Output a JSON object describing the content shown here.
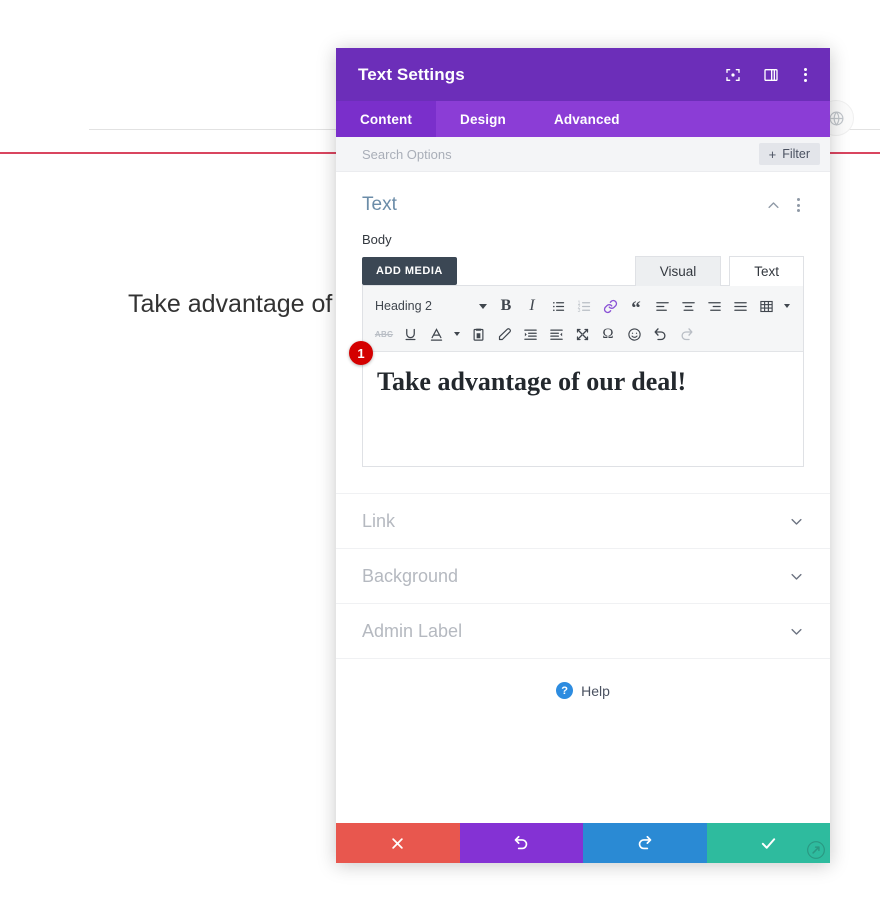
{
  "background_page": {
    "heading_text": "Take advantage of our deal!",
    "accent_rule_color": "#d9455f",
    "globe_icon": "globe-icon"
  },
  "panel": {
    "header": {
      "title": "Text Settings",
      "background_color": "#6c2eb9",
      "icons": [
        {
          "name": "focus-target-icon"
        },
        {
          "name": "layout-panel-icon"
        },
        {
          "name": "kebab-menu-icon"
        }
      ]
    },
    "tabs": {
      "background_color": "#8b3dd6",
      "active_color": "#7a2fcb",
      "items": [
        {
          "label": "Content",
          "active": true
        },
        {
          "label": "Design",
          "active": false
        },
        {
          "label": "Advanced",
          "active": false
        }
      ]
    },
    "search": {
      "value": "",
      "placeholder": "Search Options",
      "filter_label": "Filter",
      "filter_plus": "+"
    },
    "text_section": {
      "title": "Text",
      "collapse_icon": "chevron-up-icon",
      "menu_icon": "kebab-menu-icon",
      "body_label": "Body",
      "add_media_label": "ADD MEDIA",
      "editor_tabs": [
        {
          "label": "Visual",
          "active": true
        },
        {
          "label": "Text",
          "active": false
        }
      ],
      "toolbar_row1": [
        {
          "name": "format-select",
          "label": "Heading 2",
          "type": "select"
        },
        {
          "name": "bold-icon",
          "glyph": "B",
          "type": "text",
          "style": "bold-serif"
        },
        {
          "name": "italic-icon",
          "glyph": "I",
          "type": "text",
          "style": "italic-serif"
        },
        {
          "name": "bulleted-list-icon",
          "type": "svg"
        },
        {
          "name": "numbered-list-icon",
          "type": "svg"
        },
        {
          "name": "link-icon",
          "type": "svg",
          "color": "#8a52d6"
        },
        {
          "name": "blockquote-icon",
          "glyph": "“",
          "type": "text"
        },
        {
          "name": "align-left-icon",
          "type": "svg"
        },
        {
          "name": "align-center-icon",
          "type": "svg"
        },
        {
          "name": "align-right-icon",
          "type": "svg"
        },
        {
          "name": "align-justify-icon",
          "type": "svg"
        },
        {
          "name": "insert-table-icon",
          "type": "svg"
        },
        {
          "name": "table-caret-icon",
          "type": "caret"
        }
      ],
      "toolbar_row2": [
        {
          "name": "strikethrough-icon",
          "glyph": "ABC",
          "type": "abc"
        },
        {
          "name": "underline-icon",
          "type": "svg"
        },
        {
          "name": "text-color-icon",
          "type": "svg"
        },
        {
          "name": "text-color-caret-icon",
          "type": "caret"
        },
        {
          "name": "paste-as-text-icon",
          "type": "svg"
        },
        {
          "name": "clear-formatting-icon",
          "type": "svg"
        },
        {
          "name": "increase-indent-icon",
          "type": "svg"
        },
        {
          "name": "decrease-indent-icon",
          "type": "svg"
        },
        {
          "name": "fullscreen-icon",
          "type": "svg"
        },
        {
          "name": "special-character-icon",
          "glyph": "Ω",
          "type": "text"
        },
        {
          "name": "emoji-icon",
          "type": "svg"
        },
        {
          "name": "undo-icon",
          "type": "svg"
        },
        {
          "name": "redo-icon",
          "type": "svg",
          "disabled": true
        }
      ],
      "content_html_text": "Take advantage of our deal!",
      "step_badge": "1",
      "step_badge_color": "#d40000"
    },
    "collapsed_sections": [
      {
        "label": "Link",
        "icon": "chevron-down-icon"
      },
      {
        "label": "Background",
        "icon": "chevron-down-icon"
      },
      {
        "label": "Admin Label",
        "icon": "chevron-down-icon"
      }
    ],
    "help": {
      "label": "Help",
      "icon": "question-mark-icon",
      "icon_color": "#2d8ce0"
    },
    "footer_actions": [
      {
        "name": "cancel-button",
        "icon": "close-x-icon",
        "color": "#e8574e"
      },
      {
        "name": "undo-button",
        "icon": "undo-arrow-icon",
        "color": "#8432d4"
      },
      {
        "name": "redo-button",
        "icon": "redo-arrow-icon",
        "color": "#2a8ad4"
      },
      {
        "name": "save-button",
        "icon": "checkmark-icon",
        "color": "#2ebb9e"
      }
    ],
    "resize_handle": "resize-handle-icon"
  }
}
